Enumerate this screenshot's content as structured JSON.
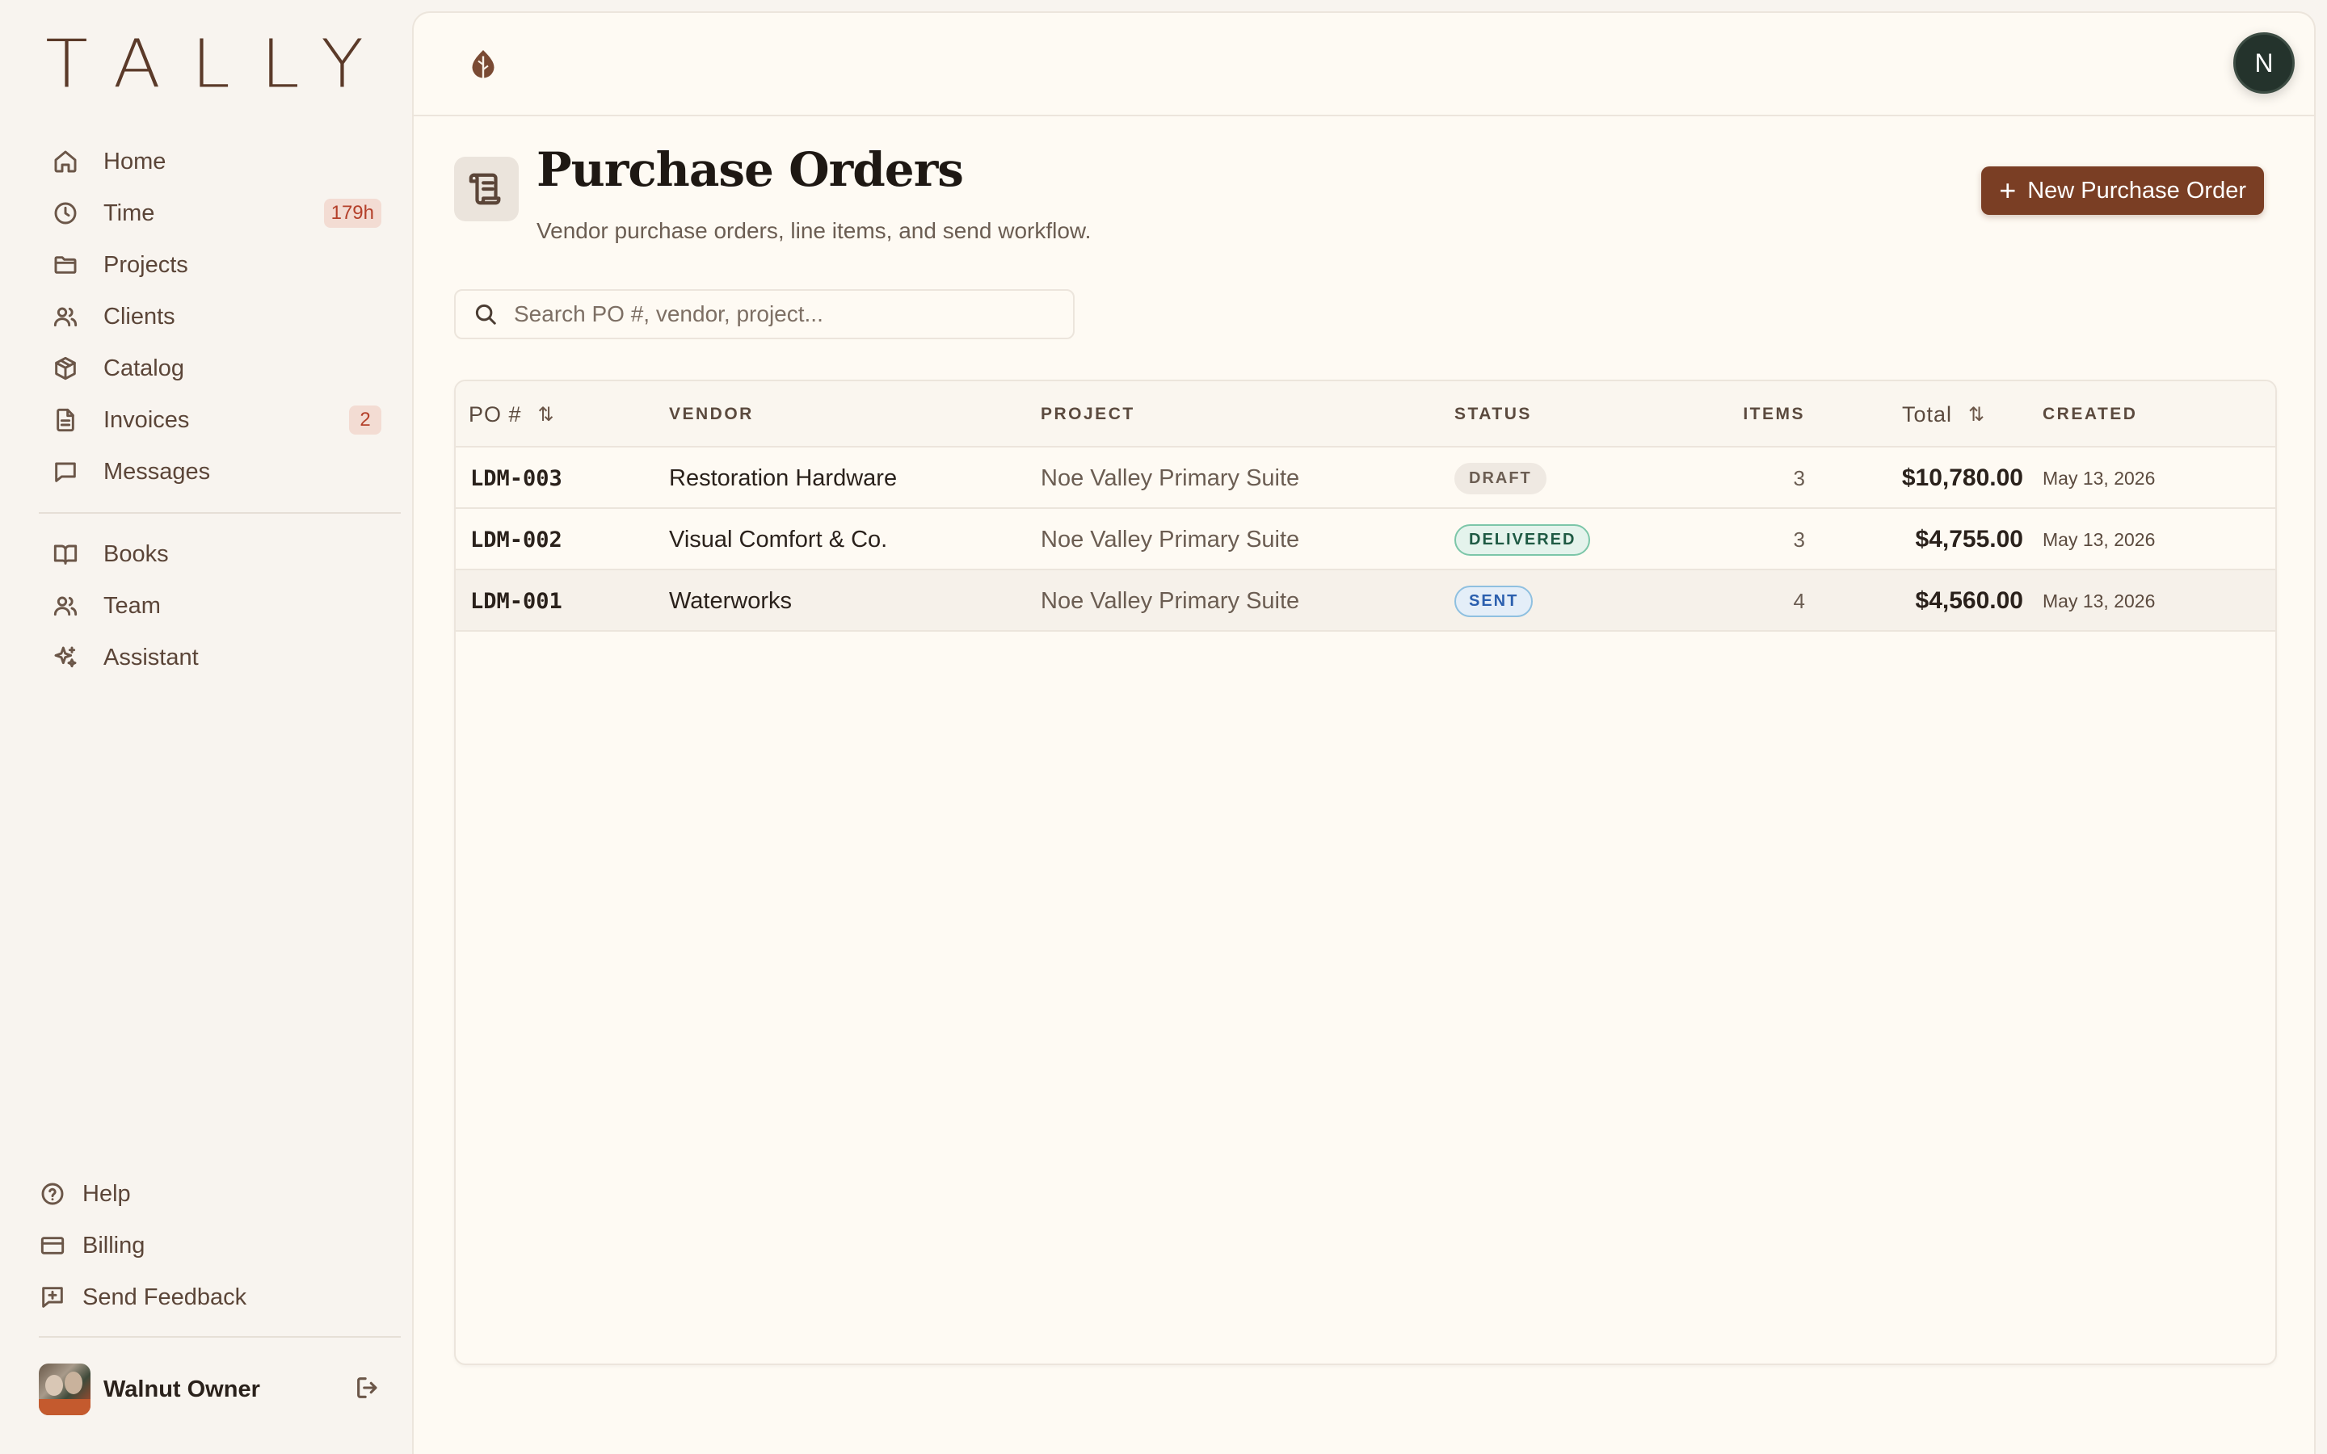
{
  "app": {
    "logo": "TALLY"
  },
  "sidebar": {
    "items": [
      {
        "label": "Home",
        "icon": "home-icon"
      },
      {
        "label": "Time",
        "icon": "clock-icon",
        "badge": "179h"
      },
      {
        "label": "Projects",
        "icon": "folder-icon"
      },
      {
        "label": "Clients",
        "icon": "users-icon"
      },
      {
        "label": "Catalog",
        "icon": "box-icon"
      },
      {
        "label": "Invoices",
        "icon": "file-icon",
        "badge": "2"
      },
      {
        "label": "Messages",
        "icon": "message-icon"
      }
    ],
    "items2": [
      {
        "label": "Books",
        "icon": "book-icon"
      },
      {
        "label": "Team",
        "icon": "user-icon"
      },
      {
        "label": "Assistant",
        "icon": "sparkle-icon"
      }
    ],
    "bottom": [
      {
        "label": "Help",
        "icon": "help-icon"
      },
      {
        "label": "Billing",
        "icon": "card-icon"
      },
      {
        "label": "Send Feedback",
        "icon": "feedback-icon"
      }
    ],
    "user": {
      "name": "Walnut Owner"
    }
  },
  "topbar": {
    "avatar_initial": "N"
  },
  "page": {
    "title": "Purchase Orders",
    "subtitle": "Vendor purchase orders, line items, and send workflow.",
    "new_button": "New Purchase Order",
    "search_placeholder": "Search PO #, vendor, project..."
  },
  "table": {
    "headers": {
      "po": "PO #",
      "vendor": "VENDOR",
      "project": "PROJECT",
      "status": "STATUS",
      "items": "ITEMS",
      "total": "Total",
      "created": "CREATED"
    },
    "rows": [
      {
        "po": "LDM-003",
        "vendor": "Restoration Hardware",
        "project": "Noe Valley Primary Suite",
        "status": "DRAFT",
        "items": "3",
        "total": "$10,780.00",
        "created": "May 13, 2026"
      },
      {
        "po": "LDM-002",
        "vendor": "Visual Comfort & Co.",
        "project": "Noe Valley Primary Suite",
        "status": "DELIVERED",
        "items": "3",
        "total": "$4,755.00",
        "created": "May 13, 2026"
      },
      {
        "po": "LDM-001",
        "vendor": "Waterworks",
        "project": "Noe Valley Primary Suite",
        "status": "SENT",
        "items": "4",
        "total": "$4,560.00",
        "created": "May 13, 2026"
      }
    ]
  },
  "colors": {
    "accent": "#7a3e24",
    "background": "#f8f4ef",
    "panel": "#fefaf3"
  }
}
